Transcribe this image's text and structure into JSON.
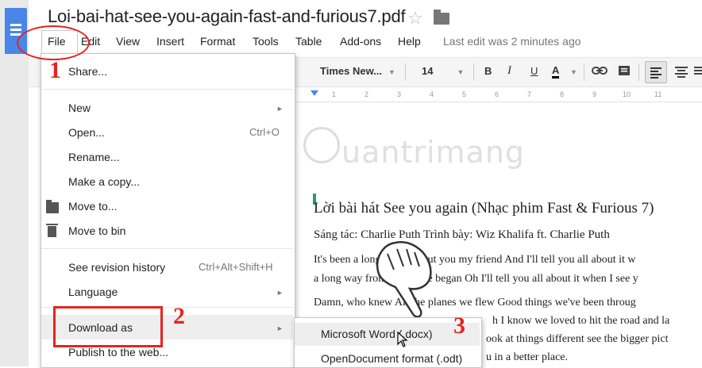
{
  "app": {
    "doc_title": "Loi-bai-hat-see-you-again-fast-and-furious7.pdf"
  },
  "menubar": {
    "items": [
      "File",
      "Edit",
      "View",
      "Insert",
      "Format",
      "Tools",
      "Table",
      "Add-ons",
      "Help"
    ],
    "last_edit": "Last edit was 2 minutes ago"
  },
  "toolbar": {
    "font": "Times New...",
    "size": "14",
    "bold": "B",
    "italic": "I",
    "underline": "U",
    "text_color": "A",
    "text_color_value": "#000000"
  },
  "ruler": {
    "marks": [
      "1",
      "2",
      "3",
      "4",
      "5",
      "6",
      "7",
      "8",
      "9",
      "10",
      "11"
    ]
  },
  "file_menu": {
    "share": "Share...",
    "new": "New",
    "open": "Open...",
    "open_shortcut": "Ctrl+O",
    "rename": "Rename...",
    "make_copy": "Make a copy...",
    "move_to": "Move to...",
    "move_to_bin": "Move to bin",
    "revision_history": "See revision history",
    "revision_shortcut": "Ctrl+Alt+Shift+H",
    "language": "Language",
    "download_as": "Download as",
    "publish": "Publish to the web..."
  },
  "download_submenu": {
    "items": [
      "Microsoft Word (.docx)",
      "OpenDocument format (.odt)"
    ],
    "highlighted": "Microsoft Word (.docx)"
  },
  "document": {
    "heading": "Lời bài hát See you again (Nhạc phim Fast & Furious 7)",
    "subheading": "Sáng tác: Charlie Puth Trình bày: Wiz Khalifa ft. Charlie Puth",
    "lines": [
      "It's been a long day without you my friend And I'll tell you all about it w",
      "a long way from where we began Oh I'll tell you all about it when I see y",
      "Damn, who knew All the planes we flew Good things we've been throug",
      "h I know we loved to hit the road and la",
      "ook at things different see the bigger pict",
      "u in a better place."
    ]
  },
  "watermark": {
    "text": "uantrimang"
  },
  "annotations": {
    "step1": "1",
    "step2": "2",
    "step3": "3",
    "color": "#e52421"
  }
}
